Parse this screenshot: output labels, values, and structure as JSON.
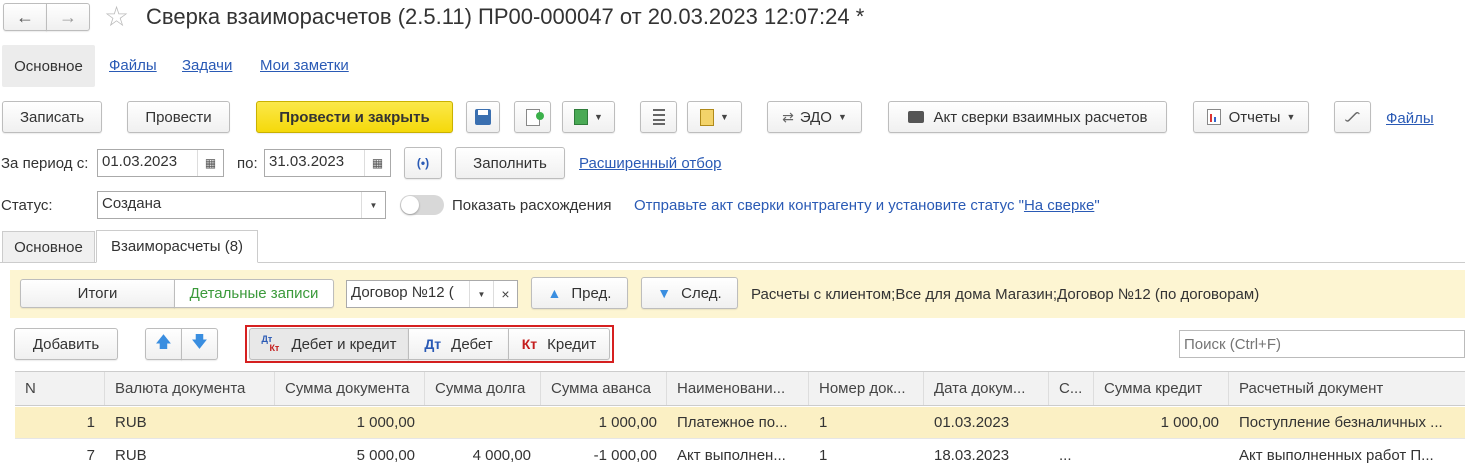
{
  "window": {
    "title": "Сверка взаиморасчетов (2.5.11) ПР00-000047 от 20.03.2023 12:07:24 *"
  },
  "nav_tabs": [
    "Основное",
    "Файлы",
    "Задачи",
    "Мои заметки"
  ],
  "toolbar": {
    "write": "Записать",
    "post": "Провести",
    "post_close": "Провести и закрыть",
    "edo": "ЭДО",
    "act": "Акт сверки взаимных расчетов",
    "reports": "Отчеты",
    "files": "Файлы"
  },
  "period": {
    "from_label": "За период с:",
    "from_value": "01.03.2023",
    "to_label": "по:",
    "to_value": "31.03.2023",
    "fill": "Заполнить",
    "ext_filter": "Расширенный отбор"
  },
  "status": {
    "label": "Статус:",
    "value": "Создана",
    "show_diff": "Показать расхождения",
    "hint_prefix": "Отправьте акт сверки контрагенту и установите статус \"",
    "hint_link": "На сверке",
    "hint_suffix": "\""
  },
  "inner_tabs": [
    "Основное",
    "Взаиморасчеты (8)"
  ],
  "filter_bar": {
    "totals": "Итоги",
    "details": "Детальные записи",
    "contract": "Договор №12 (",
    "prev": "Пред.",
    "next": "След.",
    "info": "Расчеты с клиентом;Все для дома Магазин;Договор №12 (по договорам)"
  },
  "table_toolbar": {
    "add": "Добавить",
    "debit_credit": "Дебет и кредит",
    "debit": "Дебет",
    "credit": "Кредит",
    "dt": "Дт",
    "kt": "Кт",
    "search_placeholder": "Поиск (Ctrl+F)"
  },
  "table": {
    "columns": [
      "N",
      "Валюта документа",
      "Сумма документа",
      "Сумма долга",
      "Сумма аванса",
      "Наименовани...",
      "Номер док...",
      "Дата докум...",
      "С...",
      "Сумма кредит",
      "Расчетный документ"
    ],
    "rows": [
      [
        "1",
        "RUB",
        "1 000,00",
        "",
        "1 000,00",
        "Платежное по...",
        "1",
        "01.03.2023",
        "",
        "1 000,00",
        "Поступление безналичных ..."
      ],
      [
        "7",
        "RUB",
        "5 000,00",
        "4 000,00",
        "-1 000,00",
        "Акт выполнен...",
        "1",
        "18.03.2023",
        "...",
        "",
        "Акт выполненных работ П..."
      ]
    ]
  },
  "colors": {
    "primary_button": "#f5d90a",
    "selected_row": "#fbf0c4",
    "filter_bar_bg": "#fdf5d2",
    "link": "#2a5ab5",
    "highlight_border": "#d62020"
  }
}
